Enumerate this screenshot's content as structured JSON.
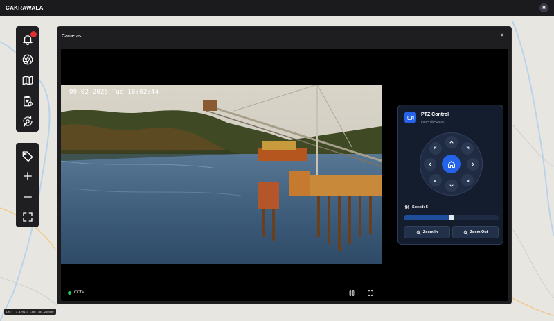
{
  "app": {
    "title": "CAKRAWALA",
    "avatar_initial": "M"
  },
  "toolbar_top": [
    "bell-icon",
    "aperture-icon",
    "map-icon",
    "clipboard-clock-icon",
    "camera-rotate-icon"
  ],
  "toolbar_bottom": [
    "tag-icon",
    "plus-icon",
    "minus-icon",
    "fullscreen-icon"
  ],
  "modal": {
    "title": "Cameras",
    "close_label": "X"
  },
  "video": {
    "timestamp": "09-02-2025 Tue 18:02:44",
    "status_label": "CCTV",
    "status_color": "#22c55e"
  },
  "ptz": {
    "title": "PTZ Control",
    "subtitle": "Pan • Tilt • Zoom",
    "speed_label": "Speed: 5",
    "speed_value": 5,
    "speed_fraction": 0.5,
    "zoom_in_label": "Zoom In",
    "zoom_out_label": "Zoom Out",
    "accent": "#2563eb"
  },
  "map": {
    "coords": "Lat: -1.429121  Lon: 104.210590"
  }
}
